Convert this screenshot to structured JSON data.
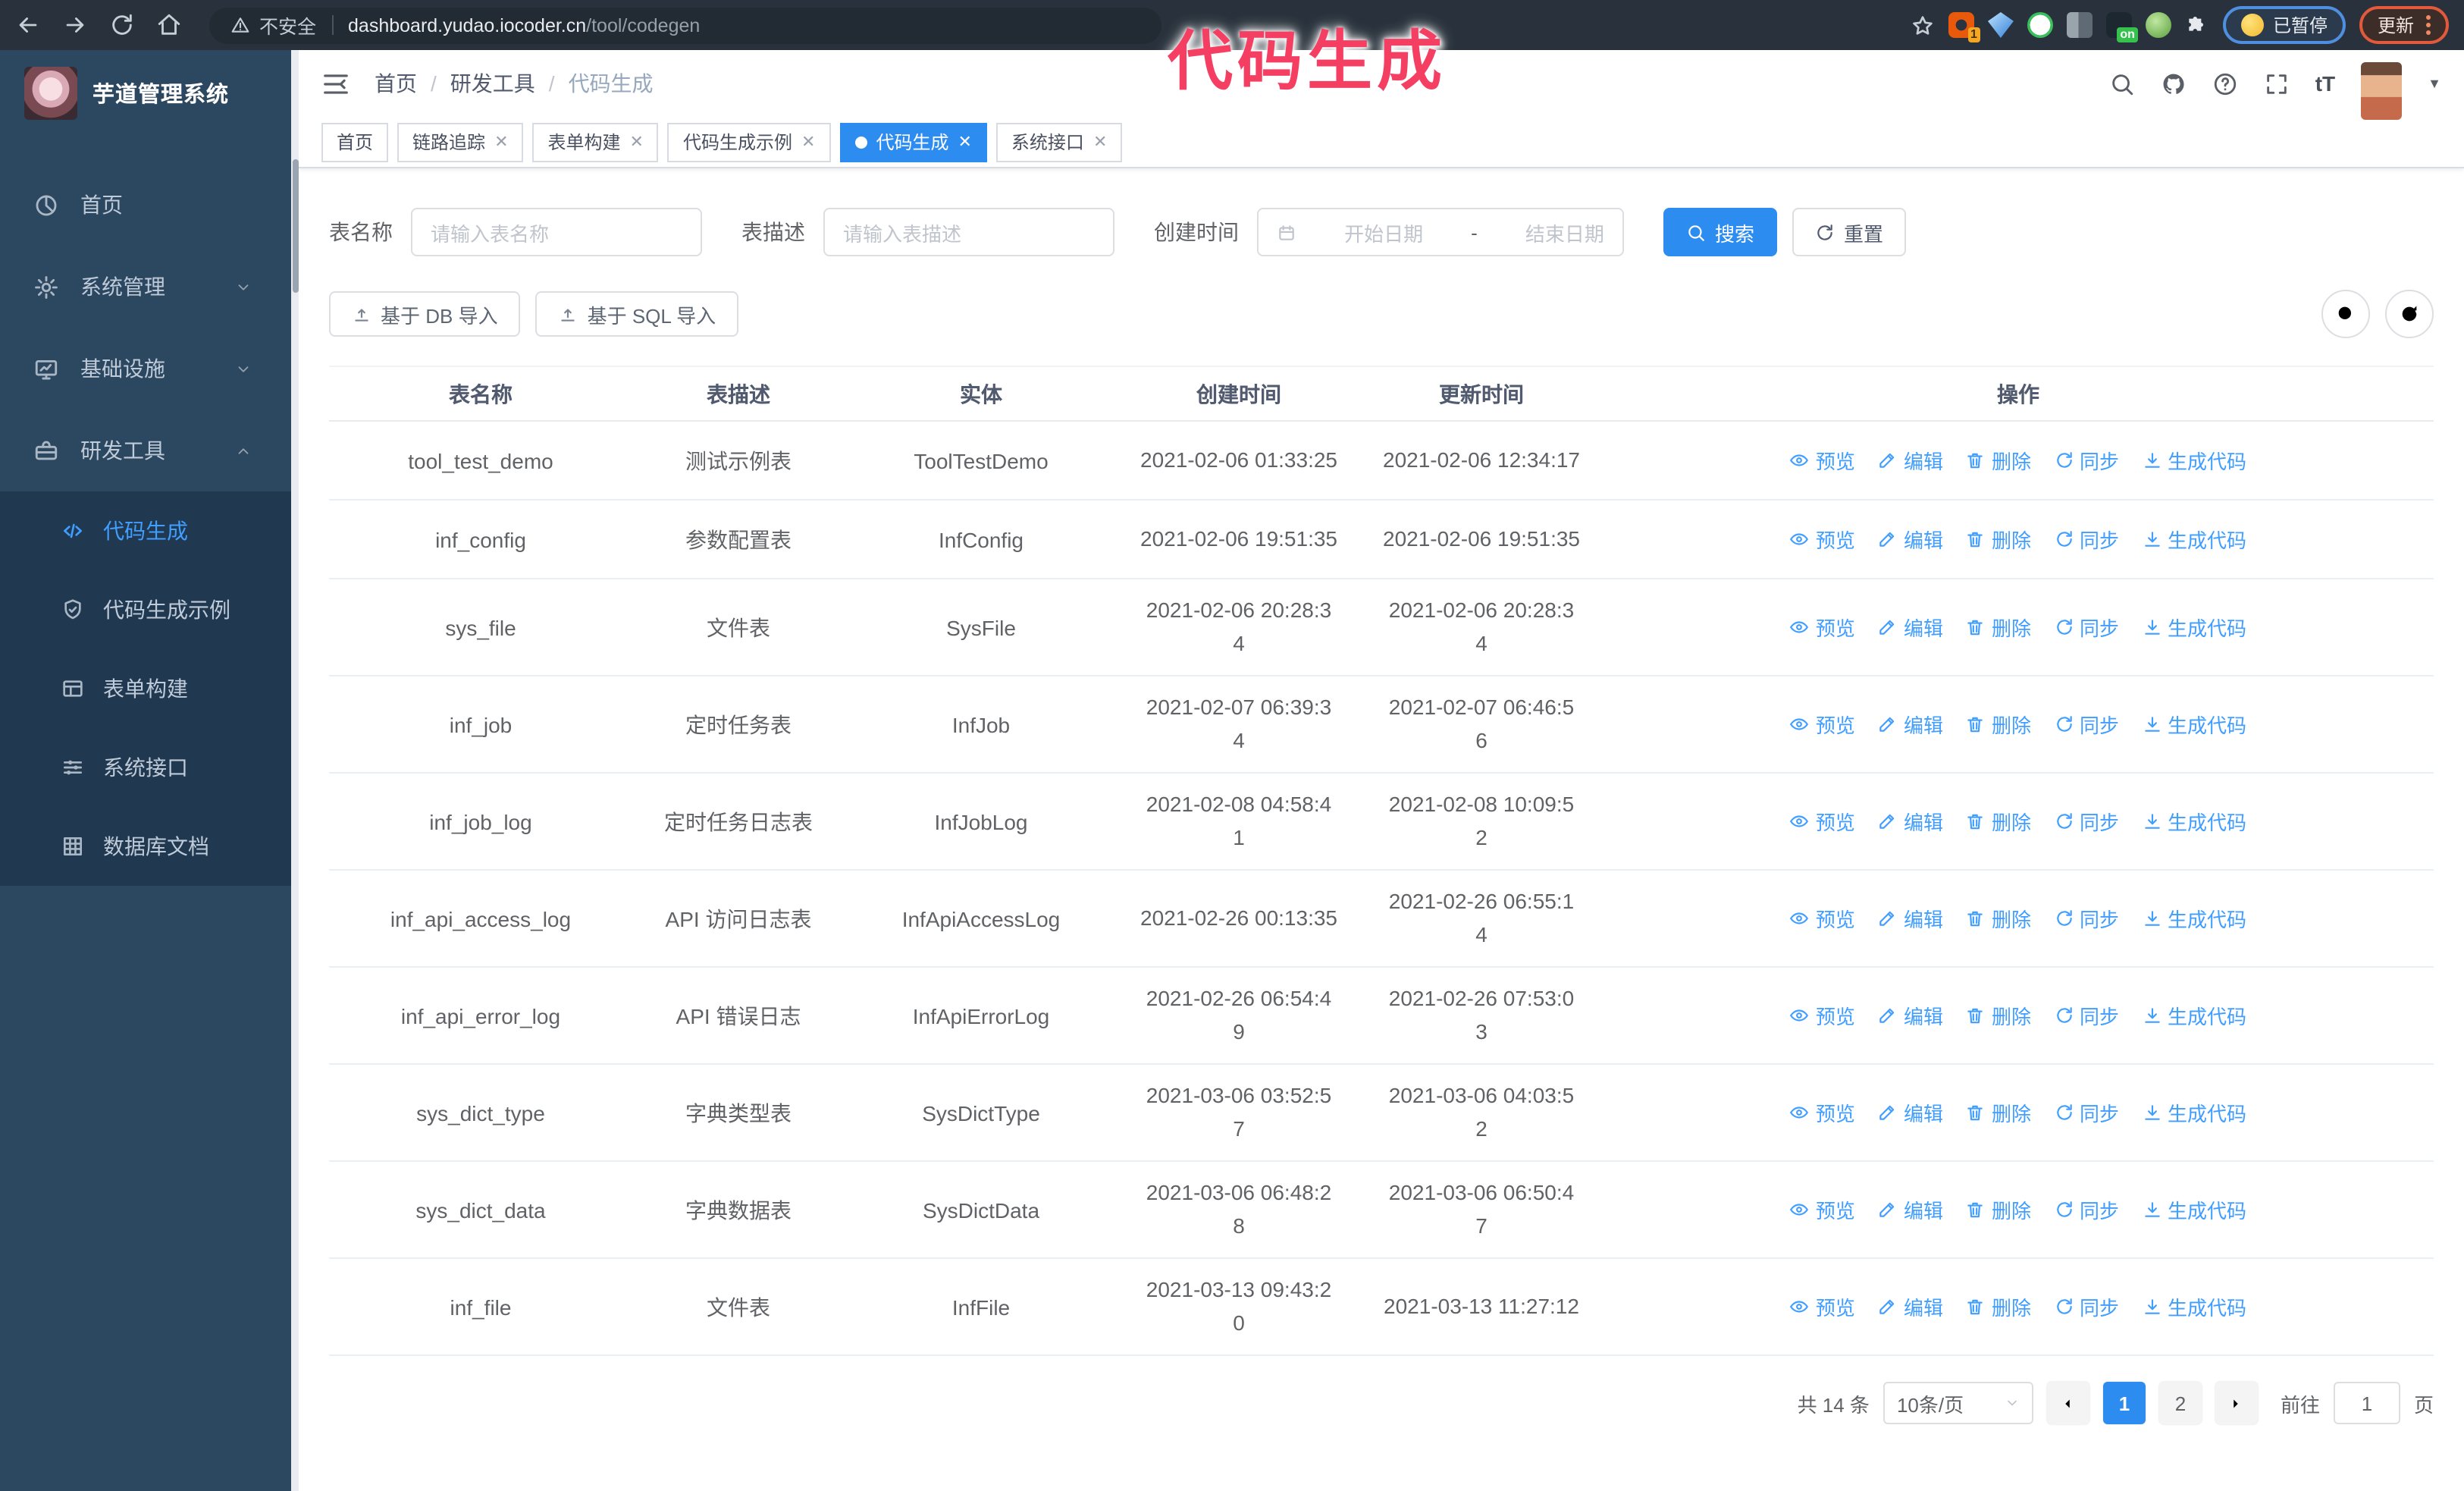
{
  "browser": {
    "security_label": "不安全",
    "url_host": "dashboard.yudao.iocoder.cn",
    "url_path": "/tool/codegen",
    "extension_badge": "1",
    "extension_on_badge": "on",
    "paused_badge": "已暂停",
    "update_button": "更新"
  },
  "annotation": {
    "text": "代码生成"
  },
  "sidebar": {
    "title": "芋道管理系统",
    "items": [
      {
        "label": "首页",
        "icon": "dashboard",
        "chevron": null,
        "active": false
      },
      {
        "label": "系统管理",
        "icon": "gear",
        "chevron": "down",
        "active": false
      },
      {
        "label": "基础设施",
        "icon": "monitor",
        "chevron": "down",
        "active": false
      },
      {
        "label": "研发工具",
        "icon": "toolbox",
        "chevron": "up",
        "active": false
      }
    ],
    "submenu": [
      {
        "label": "代码生成",
        "icon": "code",
        "active": true
      },
      {
        "label": "代码生成示例",
        "icon": "shield",
        "active": false
      },
      {
        "label": "表单构建",
        "icon": "form",
        "active": false
      },
      {
        "label": "系统接口",
        "icon": "sliders",
        "active": false
      },
      {
        "label": "数据库文档",
        "icon": "database",
        "active": false
      }
    ]
  },
  "header": {
    "breadcrumb": [
      "首页",
      "研发工具",
      "代码生成"
    ]
  },
  "tabs": [
    {
      "label": "首页",
      "closable": false,
      "active": false
    },
    {
      "label": "链路追踪",
      "closable": true,
      "active": false
    },
    {
      "label": "表单构建",
      "closable": true,
      "active": false
    },
    {
      "label": "代码生成示例",
      "closable": true,
      "active": false
    },
    {
      "label": "代码生成",
      "closable": true,
      "active": true
    },
    {
      "label": "系统接口",
      "closable": true,
      "active": false
    }
  ],
  "search_form": {
    "name_label": "表名称",
    "name_placeholder": "请输入表名称",
    "desc_label": "表描述",
    "desc_placeholder": "请输入表描述",
    "time_label": "创建时间",
    "start_placeholder": "开始日期",
    "range_separator": "-",
    "end_placeholder": "结束日期",
    "search_button": "搜索",
    "reset_button": "重置"
  },
  "toolbar": {
    "import_db_button": "基于 DB 导入",
    "import_sql_button": "基于 SQL 导入"
  },
  "table": {
    "headers": [
      "表名称",
      "表描述",
      "实体",
      "创建时间",
      "更新时间",
      "操作"
    ],
    "action_labels": [
      "预览",
      "编辑",
      "删除",
      "同步",
      "生成代码"
    ],
    "action_icons": [
      "eye",
      "pencil",
      "trash",
      "sync",
      "download"
    ],
    "rows": [
      {
        "name": "tool_test_demo",
        "desc": "测试示例表",
        "entity": "ToolTestDemo",
        "created": "2021-02-06 01:33:25",
        "updated": "2021-02-06 12:34:17"
      },
      {
        "name": "inf_config",
        "desc": "参数配置表",
        "entity": "InfConfig",
        "created": "2021-02-06 19:51:35",
        "updated": "2021-02-06 19:51:35"
      },
      {
        "name": "sys_file",
        "desc": "文件表",
        "entity": "SysFile",
        "created": "2021-02-06 20:28:3\n4",
        "updated": "2021-02-06 20:28:3\n4"
      },
      {
        "name": "inf_job",
        "desc": "定时任务表",
        "entity": "InfJob",
        "created": "2021-02-07 06:39:3\n4",
        "updated": "2021-02-07 06:46:5\n6"
      },
      {
        "name": "inf_job_log",
        "desc": "定时任务日志表",
        "entity": "InfJobLog",
        "created": "2021-02-08 04:58:4\n1",
        "updated": "2021-02-08 10:09:5\n2"
      },
      {
        "name": "inf_api_access_log",
        "desc": "API 访问日志表",
        "entity": "InfApiAccessLog",
        "created": "2021-02-26 00:13:35",
        "updated": "2021-02-26 06:55:1\n4"
      },
      {
        "name": "inf_api_error_log",
        "desc": "API 错误日志",
        "entity": "InfApiErrorLog",
        "created": "2021-02-26 06:54:4\n9",
        "updated": "2021-02-26 07:53:0\n3"
      },
      {
        "name": "sys_dict_type",
        "desc": "字典类型表",
        "entity": "SysDictType",
        "created": "2021-03-06 03:52:5\n7",
        "updated": "2021-03-06 04:03:5\n2"
      },
      {
        "name": "sys_dict_data",
        "desc": "字典数据表",
        "entity": "SysDictData",
        "created": "2021-03-06 06:48:2\n8",
        "updated": "2021-03-06 06:50:4\n7"
      },
      {
        "name": "inf_file",
        "desc": "文件表",
        "entity": "InfFile",
        "created": "2021-03-13 09:43:2\n0",
        "updated": "2021-03-13 11:27:12"
      }
    ]
  },
  "pagination": {
    "total_label": "共 14 条",
    "page_size": "10条/页",
    "pages": [
      "1",
      "2"
    ],
    "active_page": "1",
    "goto_label": "前往",
    "goto_value": "1",
    "goto_suffix": "页"
  },
  "colors": {
    "primary": "#2d8cf0",
    "link": "#3f9eff",
    "sidebar_bg": "#2c4760",
    "submenu_bg": "#203850",
    "annotation": "#f43f63"
  }
}
